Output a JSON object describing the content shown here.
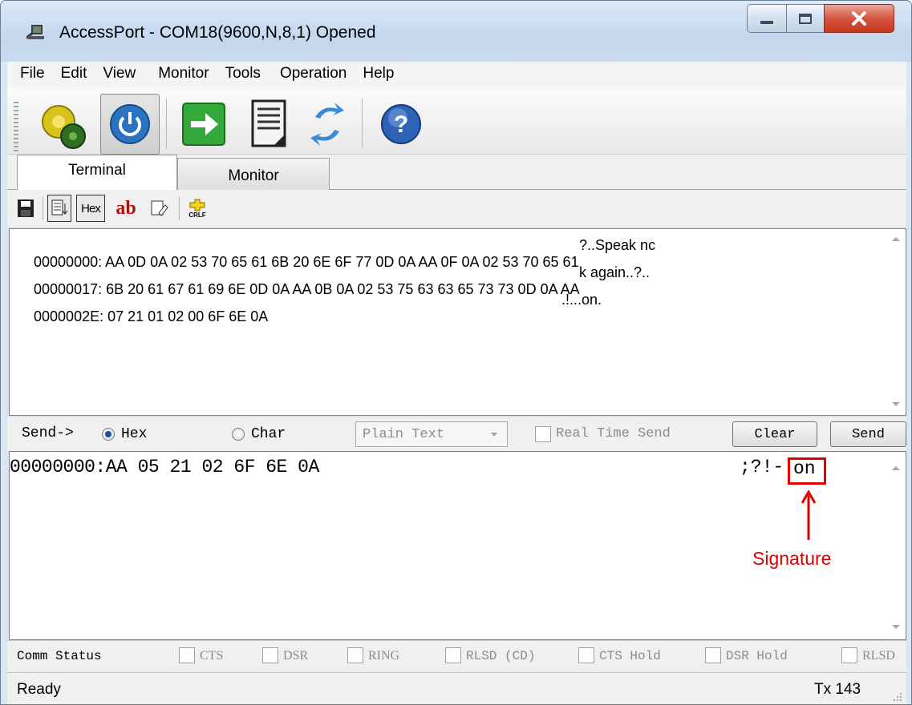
{
  "window": {
    "title": "AccessPort - COM18(9600,N,8,1) Opened"
  },
  "menu": [
    "File",
    "Edit",
    "View",
    "Monitor",
    "Tools",
    "Operation",
    "Help"
  ],
  "toolbar": {
    "icons": [
      "settings-gear-icon",
      "power-icon",
      "arrow-right-icon",
      "document-icon",
      "refresh-icon",
      "help-icon"
    ]
  },
  "tabs": {
    "terminal": "Terminal",
    "monitor": "Monitor"
  },
  "subtoolbar": {
    "hex_label": "Hex",
    "ab_label": "ab",
    "crlf_label": "CRLF"
  },
  "receive": {
    "lines": [
      {
        "addr": "00000000:",
        "hex": "AA 0D 0A 02 53 70 65 61 6B 20 6E 6F 77 0D 0A AA 0F 0A 02 53 70 65 61",
        "ascii": "?..Speak nc"
      },
      {
        "addr": "00000017:",
        "hex": "6B 20 61 67 61 69 6E 0D 0A AA 0B 0A 02 53 75 63 63 65 73 73 0D 0A AA",
        "ascii": "k again..?.."
      },
      {
        "addr": "0000002E:",
        "hex": "07 21 01 02 00 6F 6E 0A",
        "ascii": ".!...on."
      }
    ]
  },
  "sendbar": {
    "label": "Send->",
    "hex_option": "Hex",
    "char_option": "Char",
    "selected_mode": "Hex",
    "format_select": "Plain Text",
    "realtime_label": "Real Time Send",
    "clear_label": "Clear",
    "send_label": "Send"
  },
  "send_area": {
    "line": "00000000:AA 05 21 02 6F 6E 0A",
    "ascii_prefix": ";?!-",
    "signature_text": "on",
    "annotation": "Signature"
  },
  "comm_status": {
    "label": "Comm Status",
    "flags": [
      "CTS",
      "DSR",
      "RING",
      "RLSD (CD)",
      "CTS Hold",
      "DSR Hold",
      "RLSD"
    ]
  },
  "statusbar": {
    "status": "Ready",
    "tx": "Tx 143"
  },
  "colors": {
    "annotation_red": "#e00000",
    "title_bg": "#c4d7ee"
  }
}
